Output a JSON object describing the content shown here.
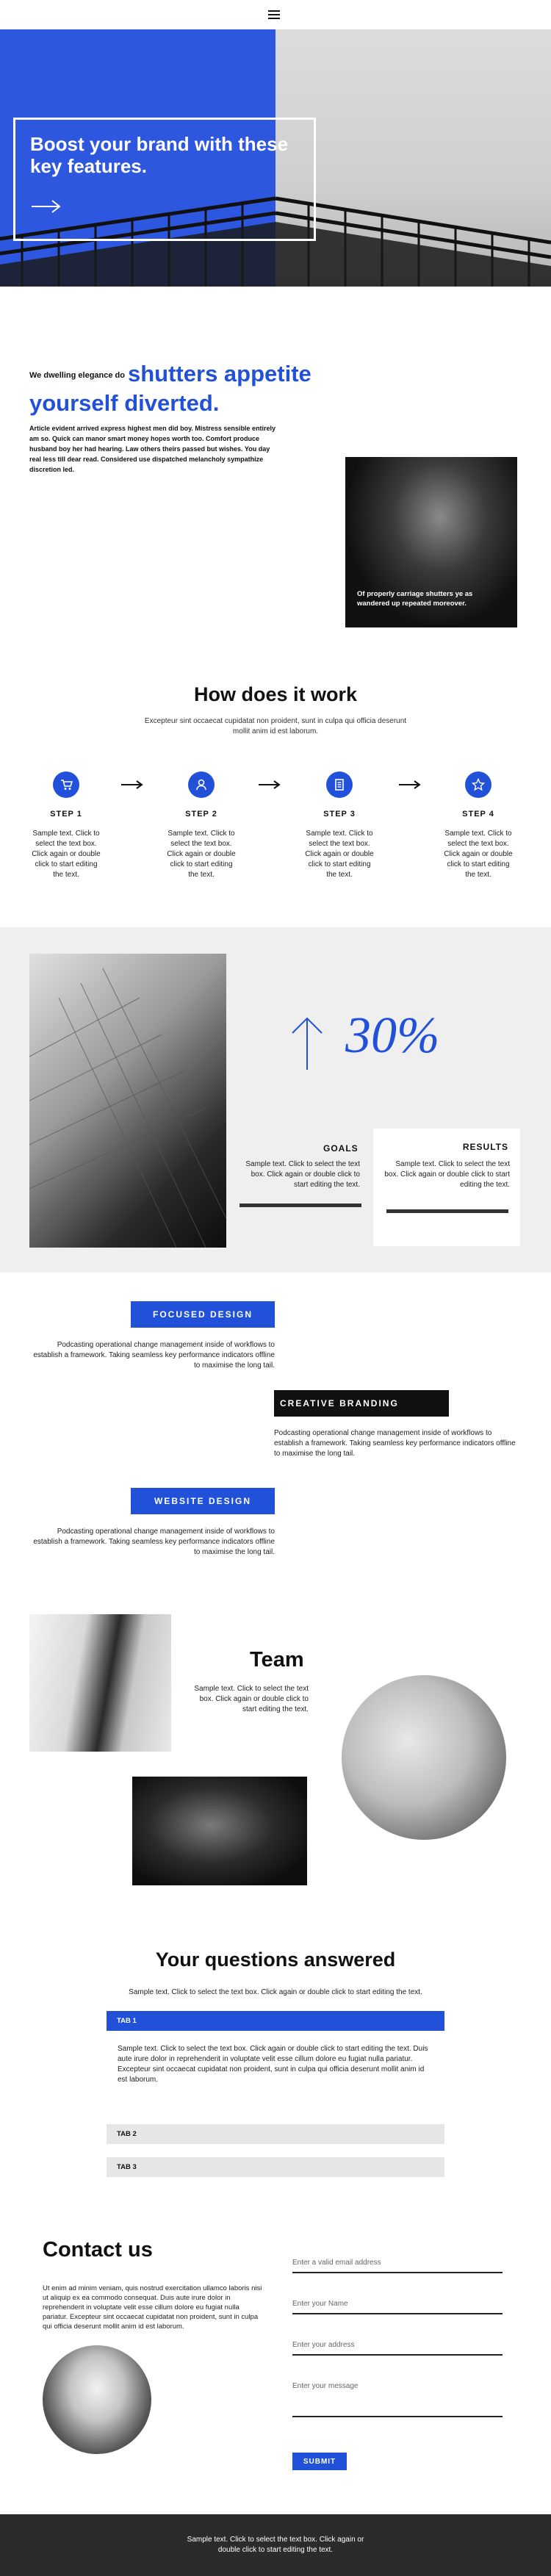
{
  "hero": {
    "title": "Boost your brand with these key features."
  },
  "intro": {
    "lead_small": "We dwelling elegance do",
    "lead_big": "shutters appetite yourself diverted.",
    "body": "Article evident arrived express highest men did boy. Mistress sensible entirely am so. Quick can manor smart money hopes worth too. Comfort produce husband boy her had hearing. Law others theirs passed but wishes. You day real less till dear read. Considered use dispatched melancholy sympathize discretion led.",
    "photo_caption": "Of properly carriage shutters ye as wandered up repeated moreover."
  },
  "how": {
    "title": "How does it work",
    "subtitle": "Excepteur sint occaecat cupidatat non proident, sunt in culpa qui officia deserunt mollit anim id est laborum.",
    "steps": [
      {
        "label": "STEP 1",
        "text": "Sample text. Click to select the text box. Click again or double click to start editing the text.",
        "icon": "cart-icon"
      },
      {
        "label": "STEP 2",
        "text": "Sample text. Click to select the text box. Click again or double click to start editing the text.",
        "icon": "user-icon"
      },
      {
        "label": "STEP 3",
        "text": "Sample text. Click to select the text box. Click again or double click to start editing the text.",
        "icon": "document-icon"
      },
      {
        "label": "STEP 4",
        "text": "Sample text. Click to select the text box. Click again or double click to start editing the text.",
        "icon": "star-icon"
      }
    ]
  },
  "stats": {
    "percent": "30%",
    "goals_title": "GOALS",
    "goals_text": "Sample text. Click to select the text box. Click again or double click to start editing the text.",
    "results_title": "RESULTS",
    "results_text": "Sample text. Click to select the text box. Click again or double click to start editing the text."
  },
  "features": [
    {
      "tag": "FOCUSED DESIGN",
      "text": "Podcasting operational change management inside of workflows to establish a framework. Taking seamless key performance indicators offline to maximise the long tail."
    },
    {
      "tag": "CREATIVE BRANDING",
      "text": "Podcasting operational change management inside of workflows to establish a framework. Taking seamless key performance indicators offline to maximise the long tail."
    },
    {
      "tag": "WEBSITE DESIGN",
      "text": "Podcasting operational change management inside of workflows to establish a framework. Taking seamless key performance indicators offline to maximise the long tail."
    }
  ],
  "team": {
    "title": "Team",
    "text": "Sample text. Click to select the text box. Click again or double click to start editing the text."
  },
  "faq": {
    "title": "Your questions answered",
    "subtitle": "Sample text. Click to select the text box. Click again or double click to start editing the text.",
    "tabs": [
      "TAB 1",
      "TAB 2",
      "TAB 3"
    ],
    "tab1_body": "Sample text. Click to select the text box. Click again or double click to start editing the text. Duis aute irure dolor in reprehenderit in voluptate velit esse cillum dolore eu fugiat nulla pariatur. Excepteur sint occaecat cupidatat non proident, sunt in culpa qui officia deserunt mollit anim id est laborum."
  },
  "contact": {
    "title": "Contact us",
    "text": "Ut enim ad minim veniam, quis nostrud exercitation ullamco laboris nisi ut aliquip ex ea commodo consequat. Duis aute irure dolor in reprehenderit in voluptate velit esse cillum dolore eu fugiat nulla pariatur. Excepteur sint occaecat cupidatat non proident, sunt in culpa qui officia deserunt mollit anim id est laborum.",
    "email_placeholder": "Enter a valid email address",
    "name_placeholder": "Enter your Name",
    "address_placeholder": "Enter your address",
    "message_placeholder": "Enter your message",
    "submit_label": "SUBMIT"
  },
  "footer": {
    "text": "Sample text. Click to select the text box. Click again or double click to start editing the text."
  },
  "colors": {
    "accent": "#2251d9",
    "dark": "#111111",
    "footer": "#2b2b2b"
  }
}
